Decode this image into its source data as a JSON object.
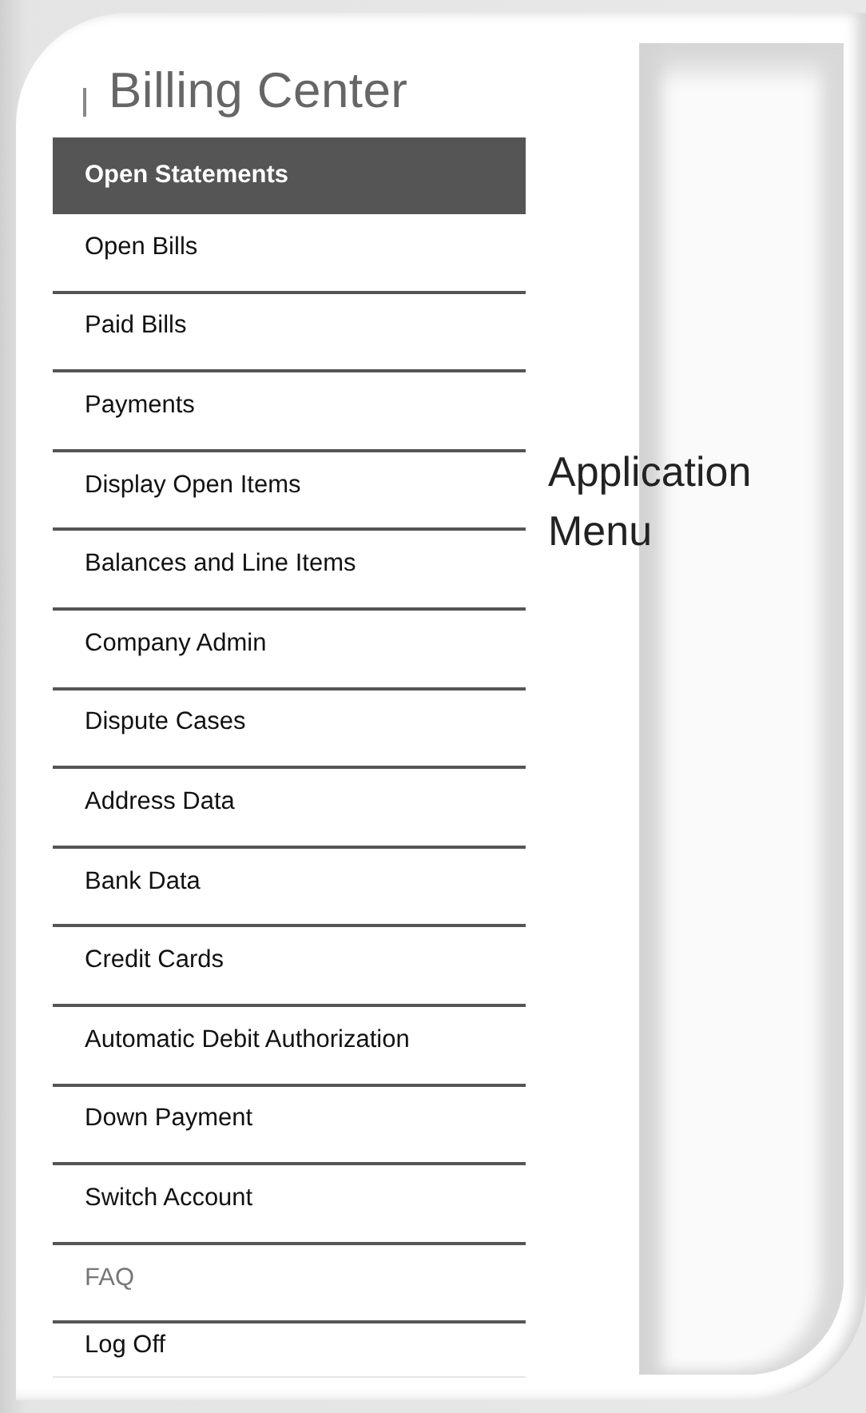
{
  "header": {
    "title": "Billing Center"
  },
  "menu": {
    "items": [
      {
        "label": "Open Statements",
        "selected": true,
        "disabled": false
      },
      {
        "label": "Open Bills",
        "selected": false,
        "disabled": false
      },
      {
        "label": "Paid Bills",
        "selected": false,
        "disabled": false
      },
      {
        "label": "Payments",
        "selected": false,
        "disabled": false
      },
      {
        "label": "Display Open Items",
        "selected": false,
        "disabled": false
      },
      {
        "label": "Balances and Line Items",
        "selected": false,
        "disabled": false
      },
      {
        "label": "Company Admin",
        "selected": false,
        "disabled": false
      },
      {
        "label": "Dispute Cases",
        "selected": false,
        "disabled": false
      },
      {
        "label": "Address Data",
        "selected": false,
        "disabled": false
      },
      {
        "label": "Bank Data",
        "selected": false,
        "disabled": false
      },
      {
        "label": "Credit Cards",
        "selected": false,
        "disabled": false
      },
      {
        "label": "Automatic Debit Authorization",
        "selected": false,
        "disabled": false
      },
      {
        "label": "Down Payment",
        "selected": false,
        "disabled": false
      },
      {
        "label": "Switch Account",
        "selected": false,
        "disabled": false
      },
      {
        "label": "FAQ",
        "selected": false,
        "disabled": true
      },
      {
        "label": "Log Off",
        "selected": false,
        "disabled": false
      }
    ]
  },
  "callout": {
    "text": "Application Menu"
  }
}
